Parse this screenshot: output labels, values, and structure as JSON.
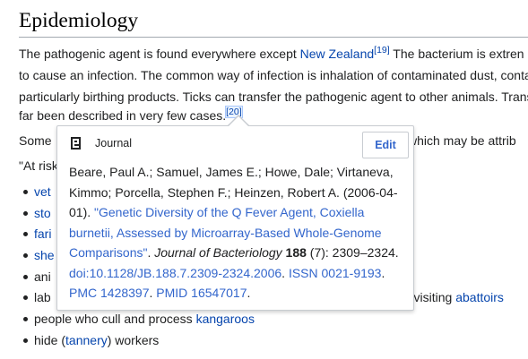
{
  "article": {
    "heading": "Epidemiology",
    "p1": {
      "l1_a": "The pathogenic agent is found everywhere except ",
      "l1_link": "New Zealand",
      "l1_ref": "[19]",
      "l1_b": " The bacterium is extren",
      "l2": "to cause an infection. The common way of infection is inhalation of contaminated dust, conta",
      "l3": "particularly birthing products. Ticks can transfer the pathogenic agent to other animals. Trans",
      "l4_a": "far been described in very few cases.",
      "l4_ref": "[20]"
    },
    "p2": {
      "left": "Some",
      "right": " which may be attrib"
    },
    "p3": {
      "left": "\"At risk"
    },
    "bullets": [
      {
        "text": "vet",
        "link": true
      },
      {
        "text": "sto",
        "link": true
      },
      {
        "text": "fari",
        "link": true
      },
      {
        "text": "she",
        "link": true
      },
      {
        "text": "ani",
        "link": false
      },
      {
        "text": "lab",
        "link": false,
        "right_text": "r visiting ",
        "right_link": "abattoirs"
      },
      {
        "text": "people who cull and process ",
        "link": false,
        "after_link": "kangaroos"
      },
      {
        "text": "hide (",
        "link": false,
        "after_link": "tannery",
        "after_text": ") workers"
      }
    ]
  },
  "popup": {
    "type_label": "Journal",
    "edit_label": "Edit",
    "citation": {
      "l1": "Beare, Paul A.; Samuel, James E.; Howe, Dale; Virtaneva,",
      "l2": "Kimmo; Porcella, Stephen F.; Heinzen, Robert A. (2006-04-",
      "l3_a": "01). ",
      "l3_link": "\"Genetic Diversity of the Q Fever Agent, Coxiella",
      "l4_link": "burnetii, Assessed by Microarray-Based Whole-Genome",
      "l5_link": "Comparisons\"",
      "l5_a": ". ",
      "l5_journal": "Journal of Bacteriology",
      "l5_b": " ",
      "l5_volume": "188",
      "l5_c": " (7): 2309–2324.",
      "l6_doi": "doi:10.1128/JB.188.7.2309-2324.2006",
      "l6_sep": ". ",
      "l6_issn": "ISSN 0021-9193",
      "l6_end": ".",
      "l7_pmc": "PMC 1428397",
      "l7_sep": ". ",
      "l7_pmid": "PMID 16547017",
      "l7_end": "."
    }
  },
  "colors": {
    "link": "#0645ad",
    "popup_link": "#36c",
    "text": "#202122"
  }
}
